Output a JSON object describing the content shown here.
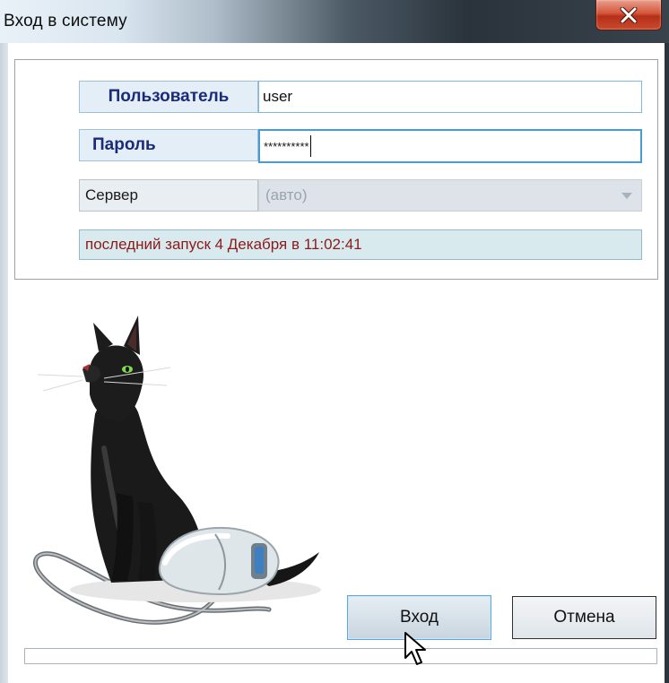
{
  "window": {
    "title": "Вход в систему",
    "close_glyph": "close-icon"
  },
  "form": {
    "user_label": "Пользователь",
    "user_value": "user",
    "password_label": "Пароль",
    "password_value": "**********",
    "server_label": "Сервер",
    "server_value": "(авто)",
    "last_launch": "последний запуск 4 Декабря в 11:02:41"
  },
  "buttons": {
    "login": "Вход",
    "cancel": "Отмена"
  },
  "progress": {
    "fraction": 0
  },
  "colors": {
    "label_text": "#1b2a7a",
    "status_text": "#8b1a1a",
    "focus_border": "#4a9ad4",
    "close_button": "#c9492c"
  }
}
